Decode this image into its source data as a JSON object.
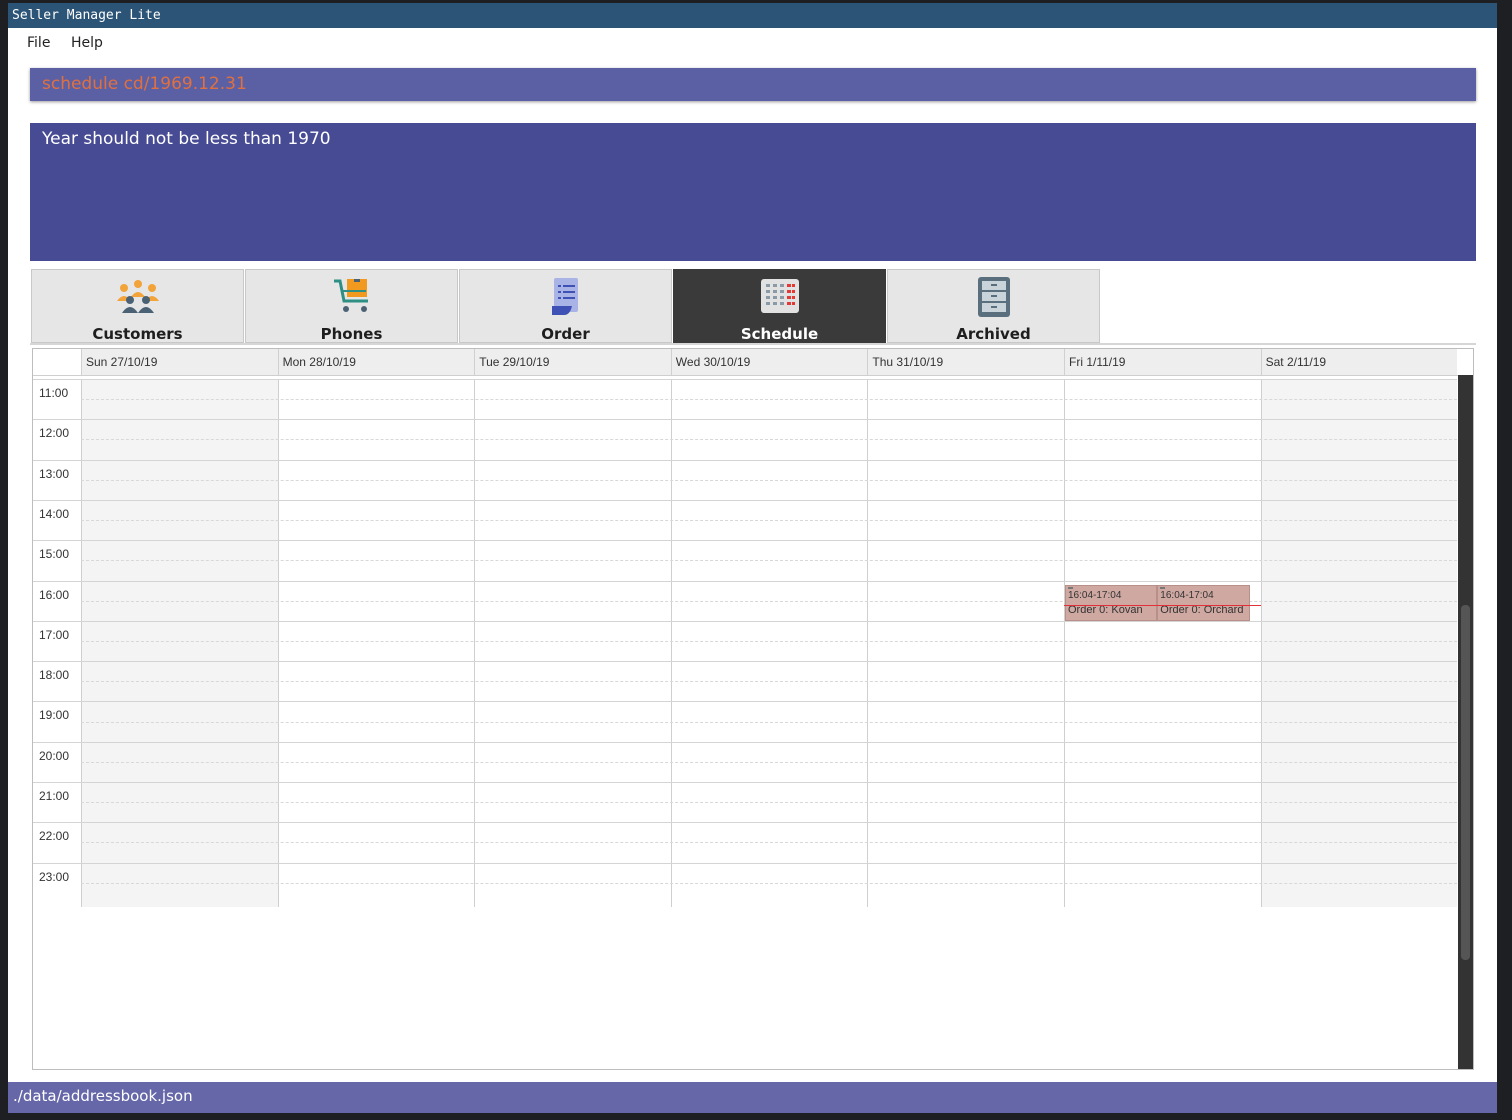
{
  "window": {
    "title": "Seller Manager Lite"
  },
  "menu": {
    "file": "File",
    "help": "Help"
  },
  "command": {
    "text": "schedule cd/1969.12.31"
  },
  "result": {
    "text": "Year should not be less than 1970"
  },
  "tabs": [
    {
      "label": "Customers",
      "icon": "customers-icon",
      "selected": false
    },
    {
      "label": "Phones",
      "icon": "cart-icon",
      "selected": false
    },
    {
      "label": "Order",
      "icon": "order-document-icon",
      "selected": false
    },
    {
      "label": "Schedule",
      "icon": "calendar-grid-icon",
      "selected": true
    },
    {
      "label": "Archived",
      "icon": "filing-cabinet-icon",
      "selected": false
    }
  ],
  "calendar": {
    "days": [
      "Sun 27/10/19",
      "Mon 28/10/19",
      "Tue 29/10/19",
      "Wed 30/10/19",
      "Thu 31/10/19",
      "Fri 1/11/19",
      "Sat 2/11/19"
    ],
    "hours": [
      "11:00",
      "12:00",
      "13:00",
      "14:00",
      "15:00",
      "16:00",
      "17:00",
      "18:00",
      "19:00",
      "20:00",
      "21:00",
      "22:00",
      "23:00"
    ],
    "appointments": [
      {
        "day": "Fri 1/11/19",
        "time": "16:04-17:04",
        "title": "Order 0: Kovan"
      },
      {
        "day": "Fri 1/11/19",
        "time": "16:04-17:04",
        "title": "Order 0: Orchard"
      }
    ]
  },
  "status": {
    "path": "./data/addressbook.json"
  },
  "colors": {
    "titlebar": "#2b5477",
    "command_bg": "#5b60a5",
    "command_text": "#e0703f",
    "result_bg": "#474b94",
    "selected_tab": "#3a3a3a",
    "appointment": "#cfa8a1",
    "current_time_line": "#e0303a",
    "statusbar": "#6667a8"
  }
}
